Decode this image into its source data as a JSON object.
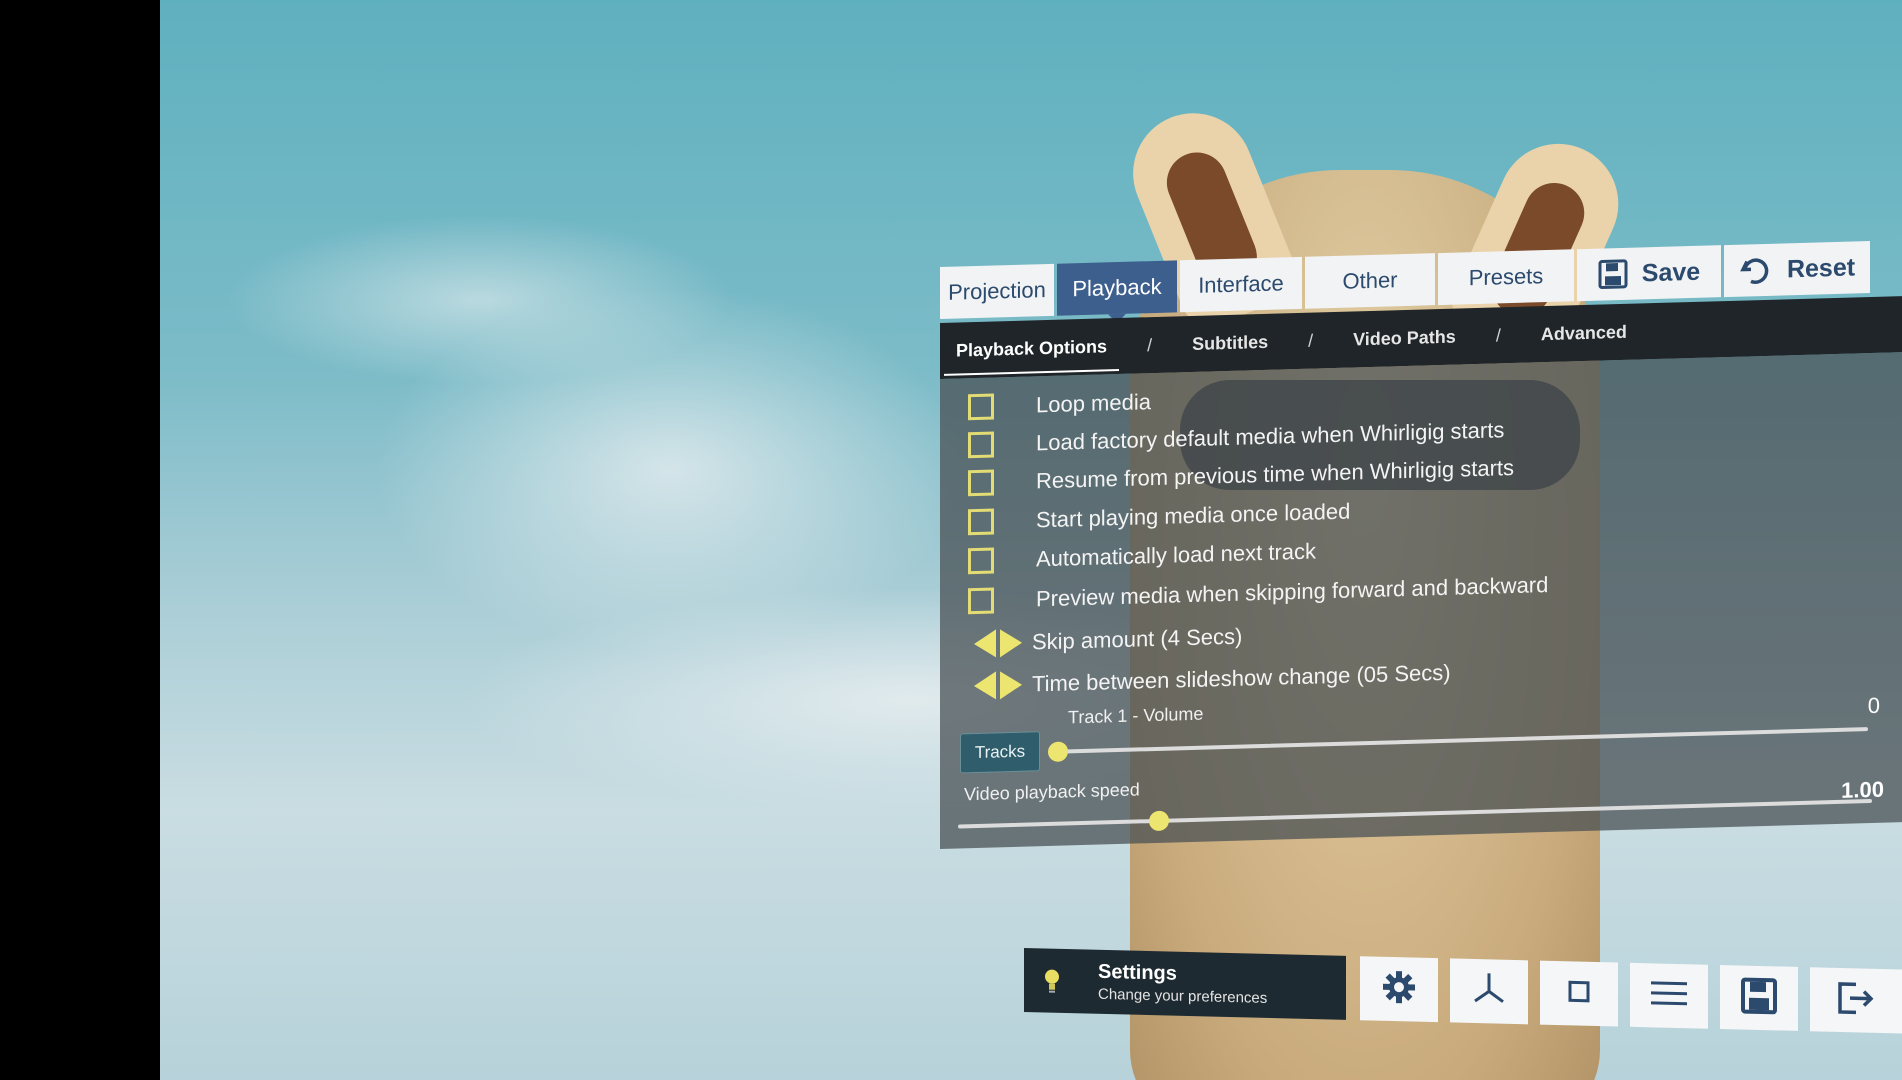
{
  "tabs": [
    {
      "label": "Projection",
      "active": false
    },
    {
      "label": "Playback",
      "active": true
    },
    {
      "label": "Interface",
      "active": false
    },
    {
      "label": "Other",
      "active": false
    },
    {
      "label": "Presets",
      "active": false
    }
  ],
  "actions": {
    "save_label": "Save",
    "reset_label": "Reset",
    "save_icon": "floppy-disk-icon",
    "reset_icon": "undo-icon"
  },
  "subtabs": [
    "Playback Options",
    "Subtitles",
    "Video Paths",
    "Advanced"
  ],
  "subtab_separator": "/",
  "options": [
    {
      "label": "Loop media",
      "checked": false
    },
    {
      "label": "Load factory default media when Whirligig starts",
      "checked": false
    },
    {
      "label": "Resume from previous time when Whirligig starts",
      "checked": false
    },
    {
      "label": "Start playing media once loaded",
      "checked": false
    },
    {
      "label": "Automatically load next track",
      "checked": false
    },
    {
      "label": "Preview media when skipping forward and backward",
      "checked": false
    }
  ],
  "steppers": [
    {
      "label": "Skip amount (4 Secs)"
    },
    {
      "label": "Time between slideshow change (05 Secs)"
    }
  ],
  "tracks_button": "Tracks",
  "volume": {
    "label": "Track 1 - Volume",
    "value": "0",
    "fraction": 0.0
  },
  "speed": {
    "label": "Video playback speed",
    "value": "1.00",
    "fraction": 0.22
  },
  "status": {
    "title": "Settings",
    "subtitle": "Change your preferences",
    "icon": "lightbulb-icon"
  },
  "toolbar_icons": [
    "gear-icon",
    "axes-icon",
    "square-icon",
    "menu-icon",
    "floppy-disk-icon",
    "exit-icon"
  ],
  "colors": {
    "accent": "#3d5f8e",
    "checkbox": "#e3dc74",
    "panel_bg": "#485054",
    "subbar_bg": "#1f2528"
  }
}
